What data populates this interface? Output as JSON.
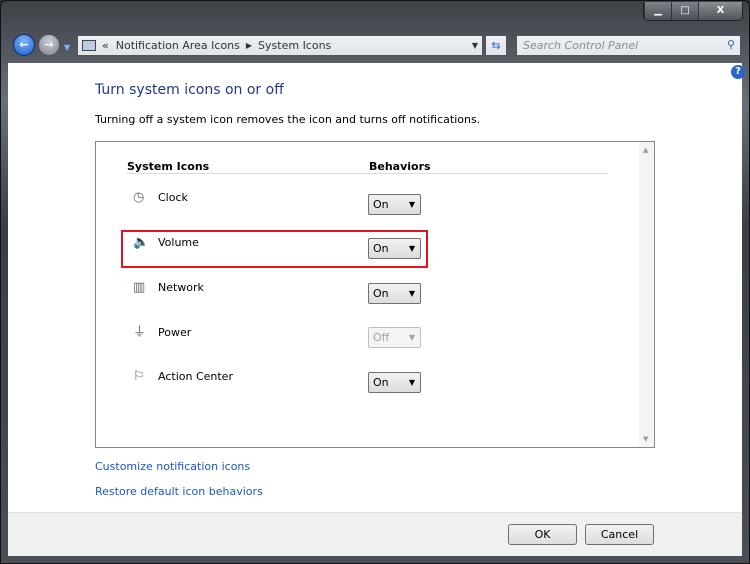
{
  "window": {
    "minimize": "▁",
    "maximize": "□",
    "close": "X"
  },
  "address": {
    "chevron": "«",
    "crumbs": [
      "Notification Area Icons",
      "System Icons"
    ]
  },
  "search": {
    "placeholder": "Search Control Panel"
  },
  "page": {
    "title": "Turn system icons on or off",
    "description": "Turning off a system icon removes the icon and turns off notifications."
  },
  "table": {
    "col_icons": "System Icons",
    "col_behaviors": "Behaviors",
    "rows": [
      {
        "label": "Clock",
        "icon": "clock-icon",
        "value": "On",
        "enabled": true
      },
      {
        "label": "Volume",
        "icon": "speaker-icon",
        "value": "On",
        "enabled": true,
        "highlighted": true
      },
      {
        "label": "Network",
        "icon": "network-icon",
        "value": "On",
        "enabled": true
      },
      {
        "label": "Power",
        "icon": "power-plug-icon",
        "value": "Off",
        "enabled": false
      },
      {
        "label": "Action Center",
        "icon": "flag-icon",
        "value": "On",
        "enabled": true
      }
    ]
  },
  "links": {
    "customize": "Customize notification icons",
    "restore": "Restore default icon behaviors"
  },
  "buttons": {
    "ok": "OK",
    "cancel": "Cancel"
  },
  "colors": {
    "highlight": "#e3141b",
    "link": "#1c56c9",
    "title": "#1e3a8a"
  }
}
